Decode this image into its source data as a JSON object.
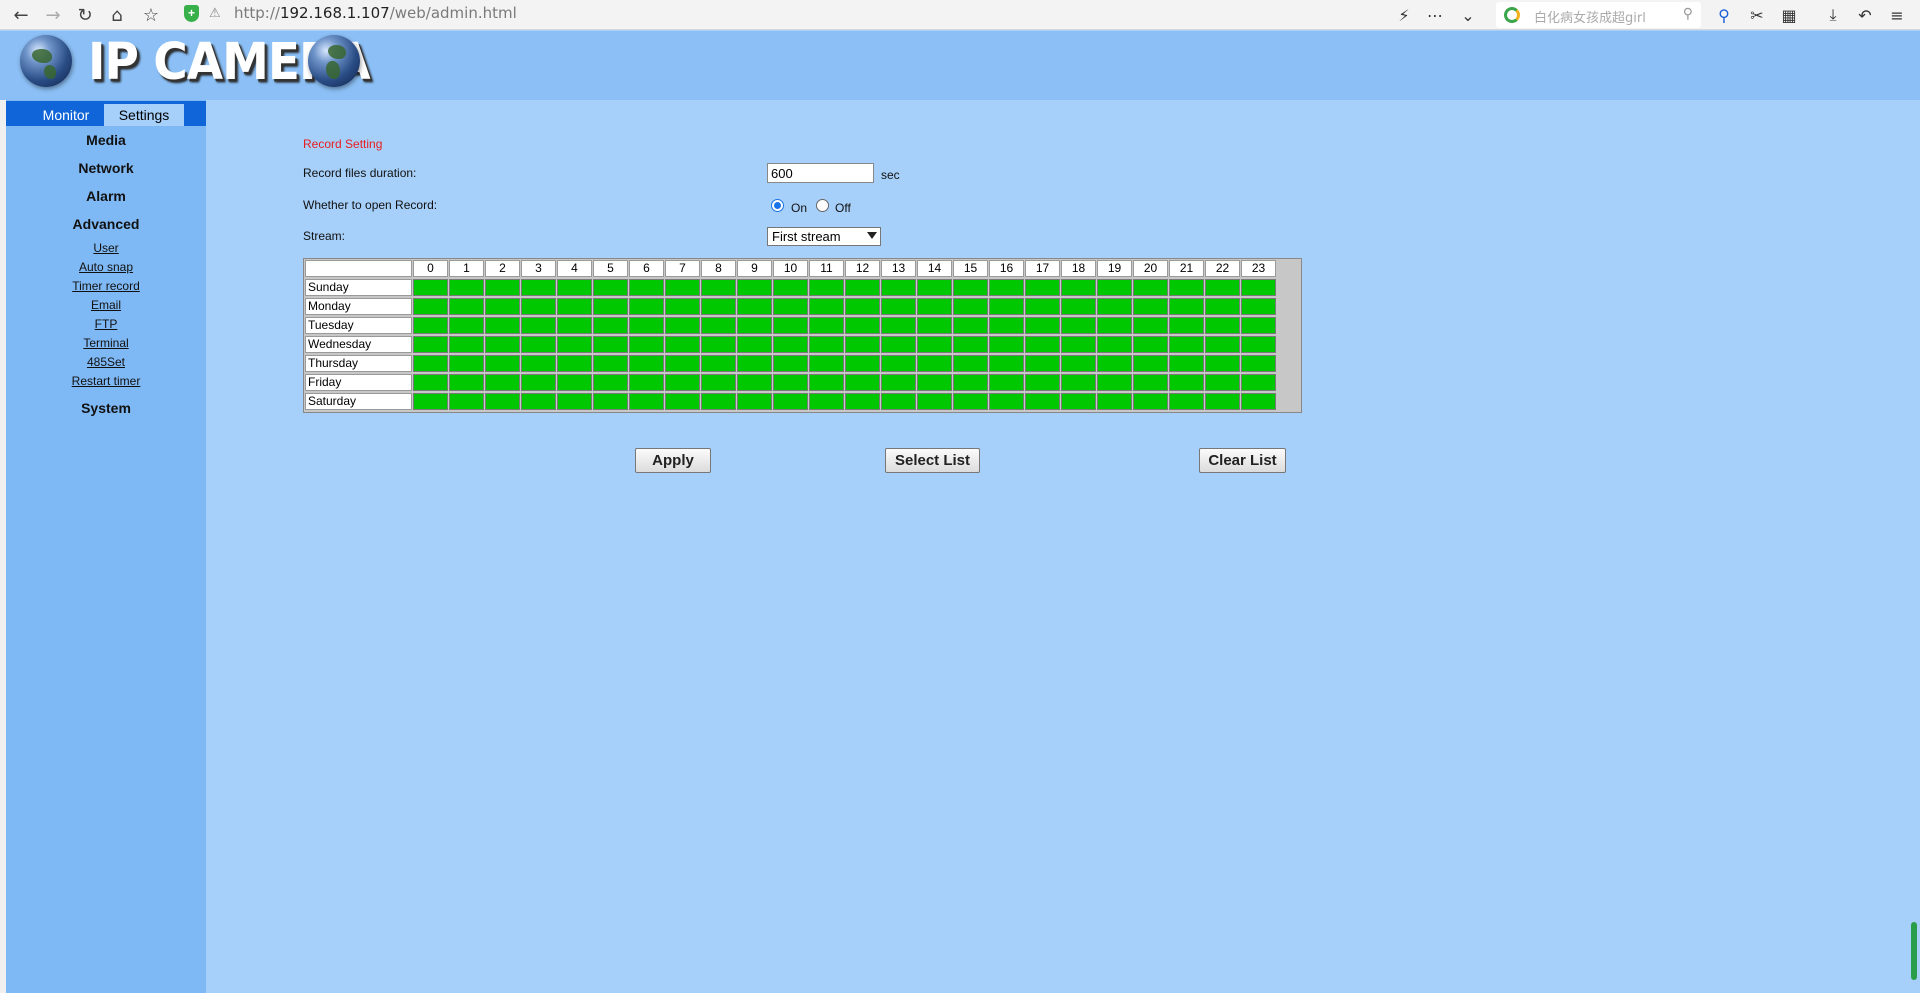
{
  "browser": {
    "url_prefix": "http://",
    "url_host": "192.168.1.107",
    "url_path": "/web/admin.html",
    "search_placeholder": "白化病女孩成超girl"
  },
  "header": {
    "logo_text": "IP CAMERA"
  },
  "tabs": {
    "monitor": "Monitor",
    "settings": "Settings"
  },
  "menu": {
    "main": [
      "Media",
      "Network",
      "Alarm",
      "Advanced",
      "System"
    ],
    "advanced_sub": [
      "User",
      "Auto snap",
      "Timer record",
      "Email",
      "FTP",
      "Terminal",
      "485Set",
      "Restart timer"
    ]
  },
  "form": {
    "title": "Record Setting",
    "duration_label": "Record files duration:",
    "duration_value": "600",
    "duration_unit": "sec",
    "open_label": "Whether to open Record:",
    "on_label": "On",
    "off_label": "Off",
    "record_on": true,
    "stream_label": "Stream:",
    "stream_value": "First stream"
  },
  "schedule": {
    "hours": [
      "0",
      "1",
      "2",
      "3",
      "4",
      "5",
      "6",
      "7",
      "8",
      "9",
      "10",
      "11",
      "12",
      "13",
      "14",
      "15",
      "16",
      "17",
      "18",
      "19",
      "20",
      "21",
      "22",
      "23"
    ],
    "days": [
      "Sunday",
      "Monday",
      "Tuesday",
      "Wednesday",
      "Thursday",
      "Friday",
      "Saturday"
    ],
    "slot_color": "#00c800",
    "all_selected": true
  },
  "buttons": {
    "apply": "Apply",
    "select_list": "Select List",
    "clear_list": "Clear List"
  }
}
